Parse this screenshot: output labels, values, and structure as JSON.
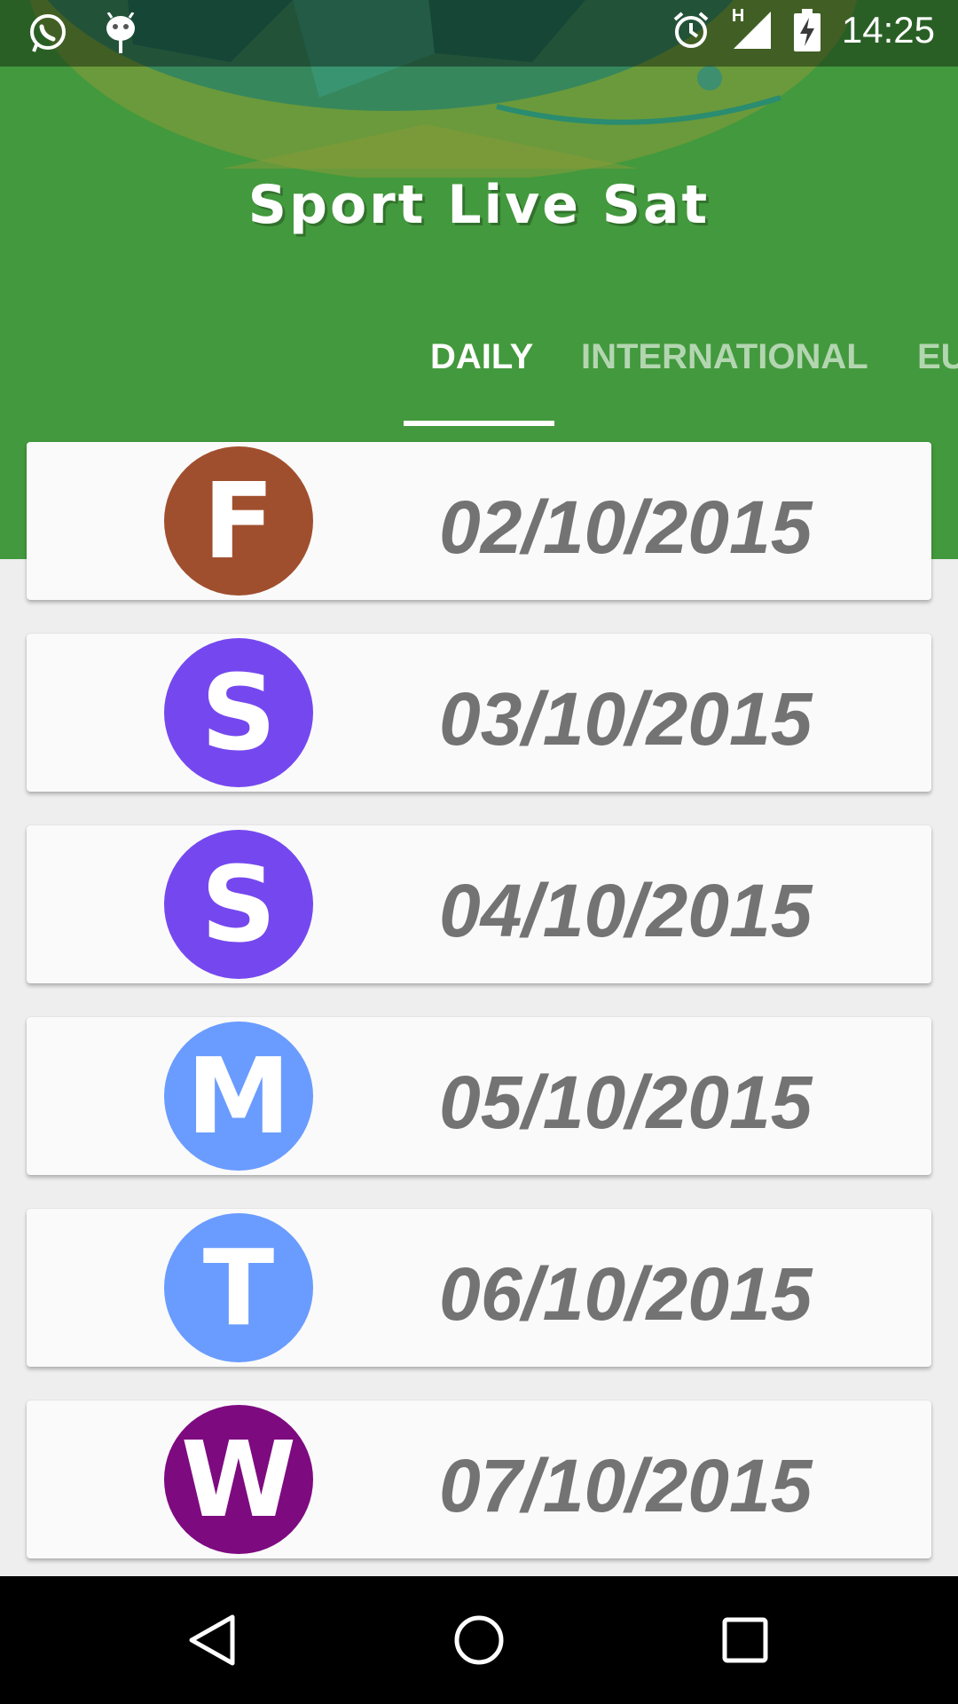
{
  "status_bar": {
    "time": "14:25",
    "network_label": "H",
    "icons": [
      "whatsapp-icon",
      "android-debug-icon",
      "alarm-icon",
      "signal-icon",
      "battery-charging-icon"
    ]
  },
  "app": {
    "title": "Sport Live Sat"
  },
  "tabs": [
    {
      "label": "DAILY",
      "active": true
    },
    {
      "label": "INTERNATIONAL",
      "active": false
    },
    {
      "label": "EU",
      "active": false
    }
  ],
  "days": [
    {
      "letter": "F",
      "date": "02/10/2015",
      "color": "#a04f2e"
    },
    {
      "letter": "S",
      "date": "03/10/2015",
      "color": "#7548ef"
    },
    {
      "letter": "S",
      "date": "04/10/2015",
      "color": "#7548ef"
    },
    {
      "letter": "M",
      "date": "05/10/2015",
      "color": "#6a9cff"
    },
    {
      "letter": "T",
      "date": "06/10/2015",
      "color": "#6a9cff"
    },
    {
      "letter": "W",
      "date": "07/10/2015",
      "color": "#7e0a80"
    }
  ],
  "nav_bar": {
    "buttons": [
      "back-icon",
      "home-icon",
      "recents-icon"
    ]
  },
  "colors": {
    "header_green": "#43993d",
    "date_text": "#737373",
    "list_background": "#eeeeee"
  }
}
